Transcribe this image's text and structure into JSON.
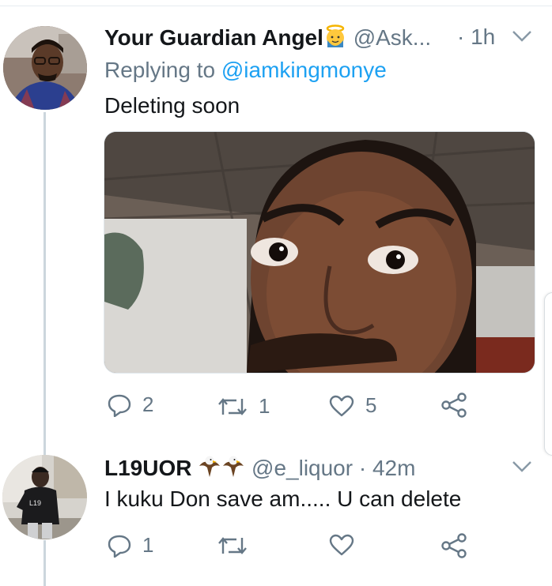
{
  "tweets": [
    {
      "name": "Your Guardian Angel",
      "name_emoji": "angel-emoji",
      "handle": "@Ask...",
      "time": "· 1h",
      "replying_prefix": "Replying to ",
      "replying_mention": "@iamkingmonye",
      "text": "Deleting soon",
      "media": "selfie-photo",
      "actions": {
        "replies": "2",
        "retweets": "1",
        "likes": "5"
      }
    },
    {
      "name": "L19UOR",
      "name_emoji": "eagle-emoji",
      "handle": "@e_liquor",
      "time": "· 42m",
      "text": "I kuku Don save am..... U can delete",
      "actions": {
        "replies": "1",
        "retweets": "",
        "likes": ""
      }
    }
  ],
  "colors": {
    "text": "#14171a",
    "secondary": "#657786",
    "link": "#1da1f2",
    "thread_line": "#ccd6dd"
  }
}
